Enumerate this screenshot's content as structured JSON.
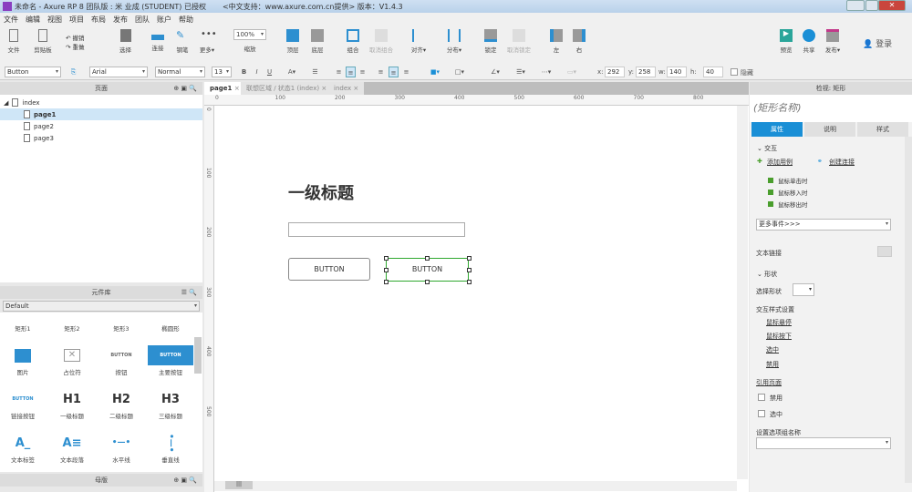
{
  "window": {
    "title": "未命名 - Axure RP 8 团队版 : 米 业成 (STUDENT) 已授权",
    "support": "<中文支持：www.axure.com.cn提供> 版本：V1.4.3"
  },
  "menu": [
    "文件",
    "编辑",
    "视图",
    "项目",
    "布局",
    "发布",
    "团队",
    "账户",
    "帮助"
  ],
  "toolbar": {
    "file": "文件",
    "clipboard": "剪贴板",
    "undo": "撤销",
    "redo": "重做",
    "select": "选择",
    "connect": "连接",
    "pen": "钢笔",
    "more": "更多▾",
    "zoom_value": "100%",
    "zoom": "缩放",
    "top": "顶层",
    "bottom": "底层",
    "group": "组合",
    "ungroup": "取消组合",
    "align": "对齐▾",
    "distribute": "分布▾",
    "lock": "锁定",
    "unlock": "取消锁定",
    "left": "左",
    "right": "右",
    "preview": "预览",
    "share": "共享",
    "publish": "发布▾",
    "login": "登录"
  },
  "format": {
    "widget_type": "Button",
    "font": "Arial",
    "weight": "Normal",
    "size": "13",
    "bold": "B",
    "italic": "I",
    "underline": "U",
    "x_label": "x:",
    "x": "292",
    "y_label": "y:",
    "y": "258",
    "w_label": "w:",
    "w": "140",
    "h_label": "h:",
    "h": "40",
    "hidden": "隐藏"
  },
  "pages": {
    "title": "页面",
    "root": "index",
    "items": [
      "page1",
      "page2",
      "page3"
    ],
    "selected": "page1"
  },
  "library": {
    "title": "元件库",
    "selected": "Default",
    "widgets": [
      {
        "label": "矩形1",
        "icon": ""
      },
      {
        "label": "矩形2",
        "icon": ""
      },
      {
        "label": "矩形3",
        "icon": ""
      },
      {
        "label": "椭圆形",
        "icon": ""
      },
      {
        "label": "图片",
        "icon": "image-icon"
      },
      {
        "label": "占位符",
        "icon": "placeholder-icon"
      },
      {
        "label": "按钮",
        "icon": "BUTTON"
      },
      {
        "label": "主要按钮",
        "icon": "BUTTON"
      },
      {
        "label": "链接按钮",
        "icon": "BUTTON"
      },
      {
        "label": "一级标题",
        "icon": "H1"
      },
      {
        "label": "二级标题",
        "icon": "H2"
      },
      {
        "label": "三级标题",
        "icon": "H3"
      },
      {
        "label": "文本标签",
        "icon": "A_"
      },
      {
        "label": "文本段落",
        "icon": "A≡"
      },
      {
        "label": "水平线",
        "icon": "hline"
      },
      {
        "label": "垂直线",
        "icon": "vline"
      }
    ]
  },
  "masters": {
    "title": "母版"
  },
  "tabs": [
    {
      "label": "page1",
      "active": true
    },
    {
      "label": "联想区域 / 状态1 (index)",
      "active": false
    },
    {
      "label": "index",
      "active": false
    }
  ],
  "ruler": {
    "h": [
      "0",
      "100",
      "200",
      "300",
      "400",
      "500",
      "600",
      "700",
      "800"
    ],
    "v": [
      "0",
      "100",
      "200",
      "300",
      "400",
      "500"
    ]
  },
  "canvas": {
    "heading": "一级标题",
    "button1": "BUTTON",
    "button2": "BUTTON"
  },
  "inspector": {
    "title": "检视: 矩形",
    "name_placeholder": "(矩形名称)",
    "tabs": [
      "属性",
      "说明",
      "样式"
    ],
    "interaction": "交互",
    "add_case": "添加用例",
    "create_link": "创建连接",
    "events": [
      "鼠标单击时",
      "鼠标移入时",
      "鼠标移出时"
    ],
    "more_events": "更多事件>>>",
    "text_link": "文本链接",
    "shape": "形状",
    "select_shape": "选择形状",
    "interaction_styles": "交互样式设置",
    "styles": [
      "鼠标悬停",
      "鼠标按下",
      "选中",
      "禁用"
    ],
    "ref_page": "引用页面",
    "disabled": "禁用",
    "selected": "选中",
    "set_group": "设置选项组名称"
  },
  "colors": {
    "accent": "#1a8fd6",
    "selection": "#2ea82e"
  }
}
